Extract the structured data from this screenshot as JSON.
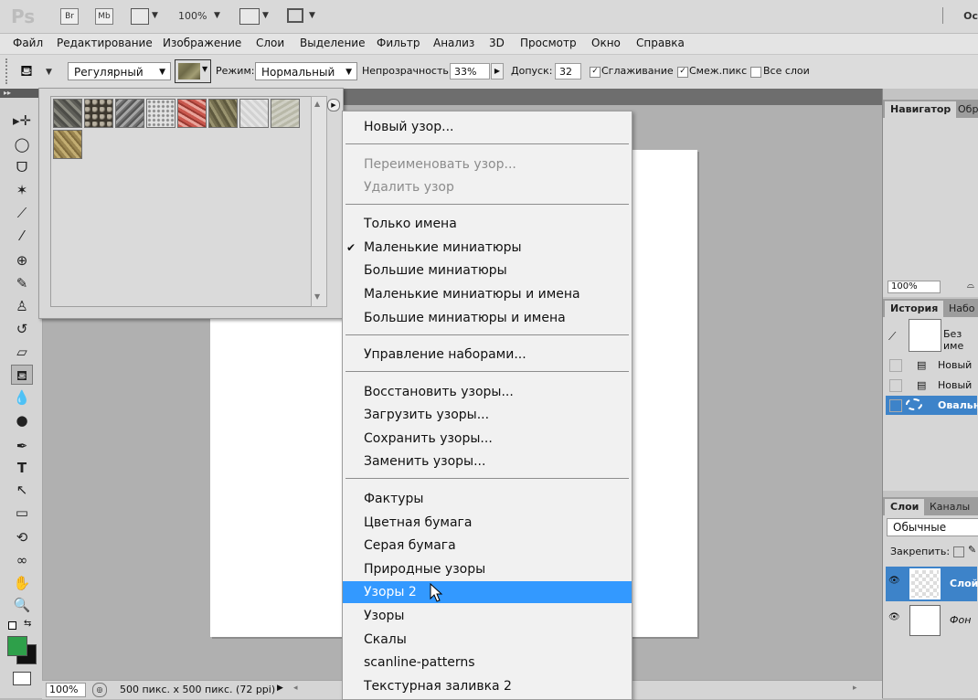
{
  "titlebar": {
    "logo": "Ps",
    "br": "Br",
    "mb": "Mb",
    "zoom": "100%",
    "right_text": "Ос"
  },
  "menu": [
    "Файл",
    "Редактирование",
    "Изображение",
    "Слои",
    "Выделение",
    "Фильтр",
    "Анализ",
    "3D",
    "Просмотр",
    "Окно",
    "Справка"
  ],
  "options": {
    "brush_type": "Регулярный",
    "mode_label": "Режим:",
    "mode_value": "Нормальный",
    "opacity_label": "Непрозрачность:",
    "opacity_value": "33%",
    "tolerance_label": "Допуск:",
    "tolerance_value": "32",
    "antialias_label": "Сглаживание",
    "contiguous_label": "Смеж.пикс",
    "all_layers_label": "Все слои"
  },
  "context_menu": {
    "items": [
      {
        "label": "Новый узор..."
      },
      {
        "label": "Переименовать узор...",
        "disabled": true
      },
      {
        "label": "Удалить узор",
        "disabled": true
      },
      {
        "label": "Только имена"
      },
      {
        "label": "Маленькие миниатюры",
        "checked": true
      },
      {
        "label": "Большие миниатюры"
      },
      {
        "label": "Маленькие миниатюры и имена"
      },
      {
        "label": "Большие миниатюры и имена"
      },
      {
        "label": "Управление наборами..."
      },
      {
        "label": "Восстановить узоры..."
      },
      {
        "label": "Загрузить узоры..."
      },
      {
        "label": "Сохранить узоры..."
      },
      {
        "label": "Заменить узоры..."
      },
      {
        "label": "Фактуры"
      },
      {
        "label": "Цветная бумага"
      },
      {
        "label": "Серая бумага"
      },
      {
        "label": "Природные узоры"
      },
      {
        "label": "Узоры 2",
        "highlighted": true
      },
      {
        "label": "Узоры"
      },
      {
        "label": "Скалы"
      },
      {
        "label": "scanline-patterns"
      },
      {
        "label": "Текстурная заливка 2"
      }
    ],
    "checkmark": "✔"
  },
  "panels": {
    "navigator_tab": "Навигатор",
    "navigator_tab2": "Обр",
    "navigator_zoom": "100%",
    "history_tab": "История",
    "history_tab2": "Набо",
    "history_snapshot": "Без име",
    "history_items": [
      "Новый",
      "Новый с",
      "Овальн"
    ],
    "layers_tab": "Слои",
    "channels_tab": "Каналы",
    "blend_mode": "Обычные",
    "lock_label": "Закрепить:",
    "layers": [
      "Слой",
      "Фон"
    ]
  },
  "status": {
    "zoom": "100%",
    "doc_info": "500 пикс. x 500 пикс. (72 ppi)"
  },
  "colors": {
    "foreground": "#2ea04a",
    "background": "#111111",
    "highlight": "#3399ff"
  }
}
